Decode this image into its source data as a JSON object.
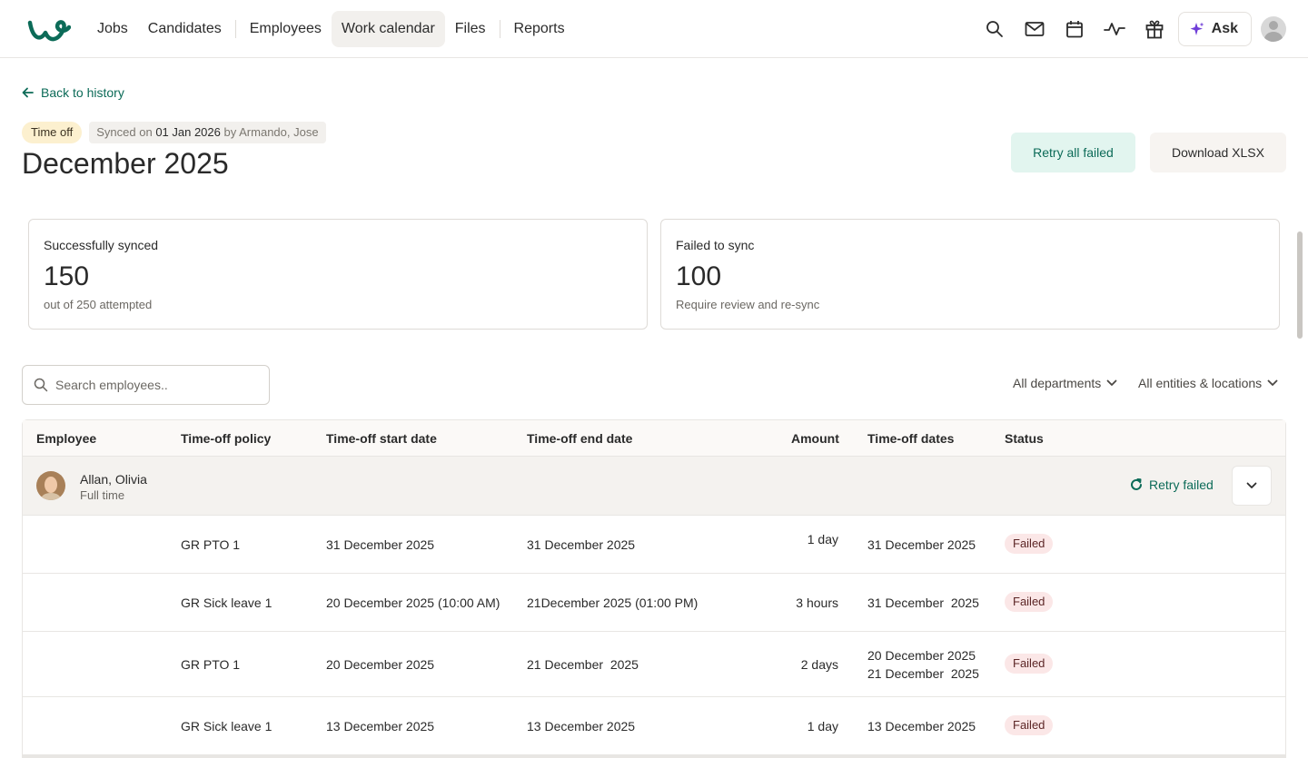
{
  "nav": {
    "items": [
      {
        "label": "Jobs"
      },
      {
        "label": "Candidates"
      },
      {
        "label": "Employees"
      },
      {
        "label": "Work calendar"
      },
      {
        "label": "Files"
      },
      {
        "label": "Reports"
      }
    ],
    "active": "Work calendar",
    "ask_label": "Ask",
    "icons": [
      "search-icon",
      "mail-icon",
      "calendar-icon",
      "activity-icon",
      "gift-icon"
    ],
    "brand_color": "#0c6b58"
  },
  "header": {
    "back_label": "Back to history",
    "type_badge": "Time off",
    "synced_prefix": "Synced on",
    "synced_date": "01 Jan 2026",
    "synced_by": "by Armando, Jose",
    "title": "December 2025",
    "retry_all_label": "Retry all failed",
    "download_label": "Download XLSX"
  },
  "summary": {
    "success": {
      "label": "Successfully synced",
      "value": "150",
      "sub": "out of 250 attempted"
    },
    "failed": {
      "label": "Failed to sync",
      "value": "100",
      "sub": "Require review and re-sync"
    }
  },
  "filters": {
    "search_placeholder": "Search employees..",
    "departments": "All departments",
    "entities": "All entities & locations"
  },
  "table": {
    "columns": [
      "Employee",
      "Time-off policy",
      "Time-off start date",
      "Time-off end date",
      "Amount",
      "Time-off dates",
      "Status"
    ],
    "group": {
      "name": "Allan, Olivia",
      "type": "Full time",
      "retry_label": "Retry failed"
    },
    "rows": [
      {
        "policy": "GR PTO 1",
        "start": "31 December 2025",
        "end": "31 December 2025",
        "amount": "1 day",
        "dates": [
          "31 December 2025"
        ],
        "status": "Failed"
      },
      {
        "policy": "GR Sick leave 1",
        "start": "20 December 2025 (10:00 AM)",
        "end": "21December 2025 (01:00 PM)",
        "amount": "3 hours",
        "dates": [
          "31 December  2025"
        ],
        "status": "Failed"
      },
      {
        "policy": "GR PTO 1",
        "start": "20 December 2025",
        "end": "21 December  2025",
        "amount": "2 days",
        "dates": [
          "20 December 2025",
          "21 December  2025"
        ],
        "status": "Failed"
      },
      {
        "policy": "GR Sick leave 1",
        "start": "13 December 2025",
        "end": "13 December 2025",
        "amount": "1 day",
        "dates": [
          "13 December 2025"
        ],
        "status": "Failed"
      }
    ],
    "status_color": "#fbe7e7"
  }
}
